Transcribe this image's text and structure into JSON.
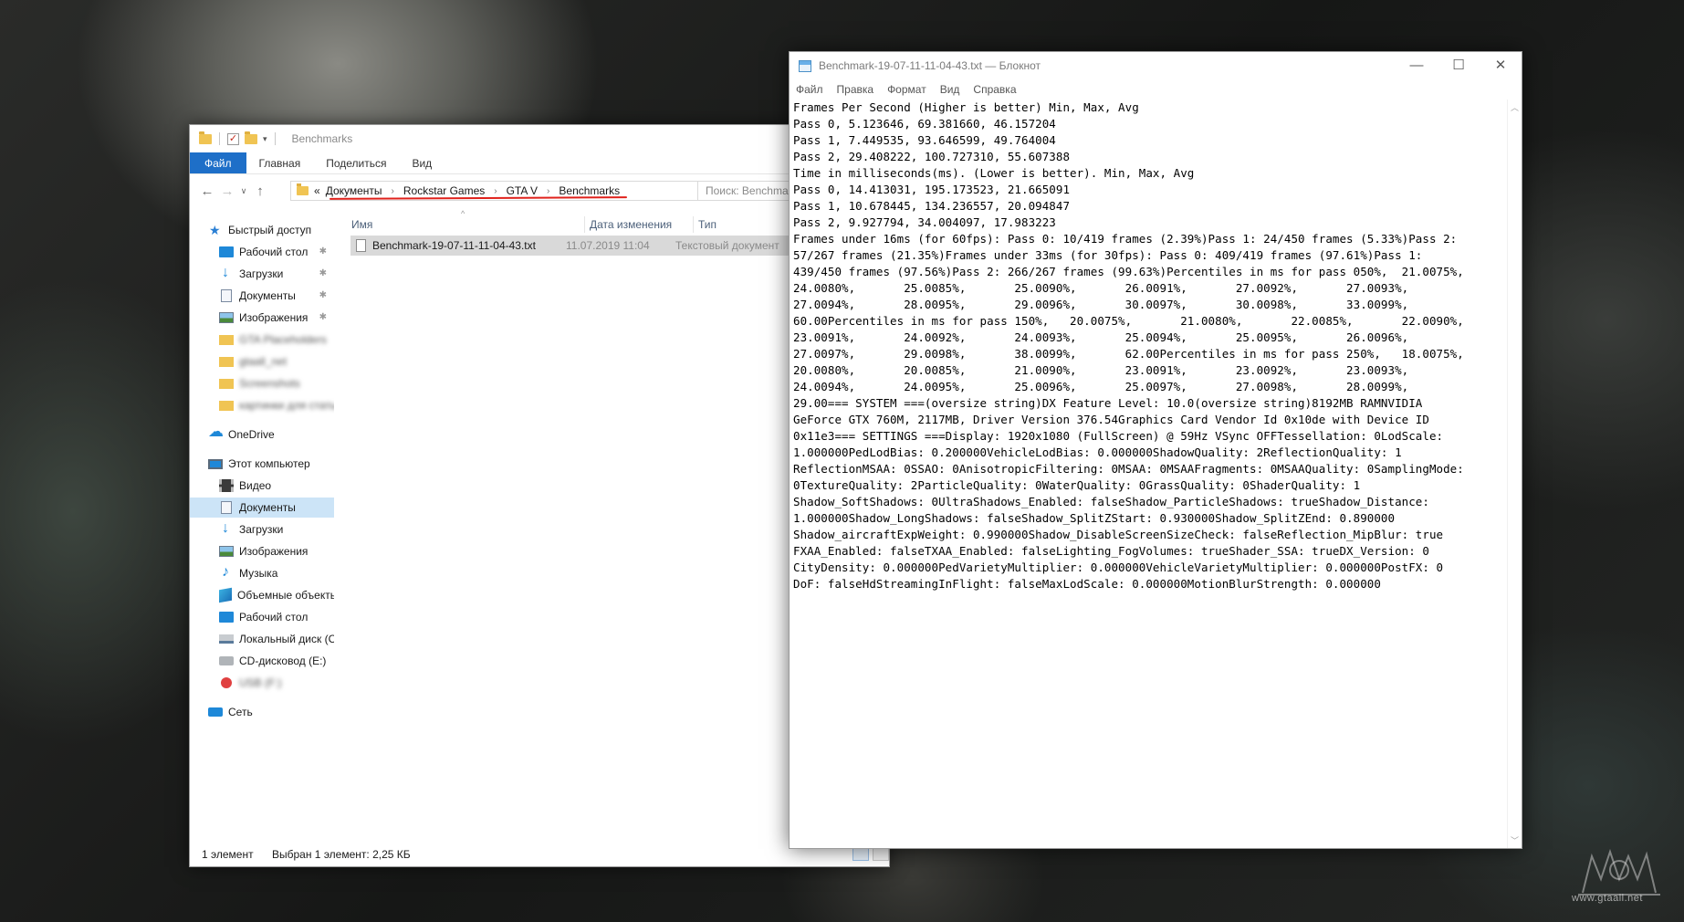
{
  "explorer": {
    "title": "Benchmarks",
    "ribbon_tabs": [
      "Файл",
      "Главная",
      "Поделиться",
      "Вид"
    ],
    "address": {
      "overflow": "«",
      "crumbs": [
        "Документы",
        "Rockstar Games",
        "GTA V",
        "Benchmarks"
      ]
    },
    "search_placeholder": "Поиск: Benchmarks",
    "nav": {
      "quick_access": "Быстрый доступ",
      "quick_items": [
        "Рабочий стол",
        "Загрузки",
        "Документы",
        "Изображения"
      ],
      "blurred_items": [
        "GTA Placeholders",
        "gtaall_net",
        "Screenshots",
        "картинки для статьи"
      ],
      "onedrive": "OneDrive",
      "this_pc": "Этот компьютер",
      "pc_items": [
        "Видео",
        "Документы",
        "Загрузки",
        "Изображения",
        "Музыка",
        "Объемные объекты",
        "Рабочий стол",
        "Локальный диск (C:)",
        "CD-дисковод (E:)"
      ],
      "blurred_drive": "USB (F:)",
      "network": "Сеть"
    },
    "columns": {
      "name": "Имя",
      "date": "Дата изменения",
      "type": "Тип"
    },
    "file": {
      "name": "Benchmark-19-07-11-11-04-43.txt",
      "date": "11.07.2019 11:04",
      "type": "Текстовый документ"
    },
    "status": {
      "count": "1 элемент",
      "selected": "Выбран 1 элемент: 2,25 КБ"
    }
  },
  "notepad": {
    "title": "Benchmark-19-07-11-11-04-43.txt — Блокнот",
    "menu": [
      "Файл",
      "Правка",
      "Формат",
      "Вид",
      "Справка"
    ],
    "lines": [
      "Frames Per Second (Higher is better) Min, Max, Avg",
      "Pass 0, 5.123646, 69.381660, 46.157204",
      "Pass 1, 7.449535, 93.646599, 49.764004",
      "Pass 2, 29.408222, 100.727310, 55.607388",
      "Time in milliseconds(ms). (Lower is better). Min, Max, Avg",
      "Pass 0, 14.413031, 195.173523, 21.665091",
      "Pass 1, 10.678445, 134.236557, 20.094847",
      "Pass 2, 9.927794, 34.004097, 17.983223",
      "Frames under 16ms (for 60fps): Pass 0: 10/419 frames (2.39%)Pass 1: 24/450 frames (5.33%)Pass 2:",
      "57/267 frames (21.35%)Frames under 33ms (for 30fps): Pass 0: 409/419 frames (97.61%)Pass 1:",
      "439/450 frames (97.56%)Pass 2: 266/267 frames (99.63%)Percentiles in ms for pass 050%,  21.0075%,",
      "24.0080%,       25.0085%,       25.0090%,       26.0091%,       27.0092%,       27.0093%,",
      "27.0094%,       28.0095%,       29.0096%,       30.0097%,       30.0098%,       33.0099%,",
      "60.00Percentiles in ms for pass 150%,   20.0075%,       21.0080%,       22.0085%,       22.0090%,",
      "23.0091%,       24.0092%,       24.0093%,       25.0094%,       25.0095%,       26.0096%,",
      "27.0097%,       29.0098%,       38.0099%,       62.00Percentiles in ms for pass 250%,   18.0075%,",
      "20.0080%,       20.0085%,       21.0090%,       23.0091%,       23.0092%,       23.0093%,",
      "24.0094%,       24.0095%,       25.0096%,       25.0097%,       27.0098%,       28.0099%,",
      "29.00=== SYSTEM ===(oversize string)DX Feature Level: 10.0(oversize string)8192MB RAMNVIDIA",
      "GeForce GTX 760M, 2117MB, Driver Version 376.54Graphics Card Vendor Id 0x10de with Device ID",
      "0x11e3=== SETTINGS ===Display: 1920x1080 (FullScreen) @ 59Hz VSync OFFTessellation: 0LodScale:",
      "1.000000PedLodBias: 0.200000VehicleLodBias: 0.000000ShadowQuality: 2ReflectionQuality: 1",
      "ReflectionMSAA: 0SSAO: 0AnisotropicFiltering: 0MSAA: 0MSAAFragments: 0MSAAQuality: 0SamplingMode:",
      "0TextureQuality: 2ParticleQuality: 0WaterQuality: 0GrassQuality: 0ShaderQuality: 1",
      "Shadow_SoftShadows: 0UltraShadows_Enabled: falseShadow_ParticleShadows: trueShadow_Distance:",
      "1.000000Shadow_LongShadows: falseShadow_SplitZStart: 0.930000Shadow_SplitZEnd: 0.890000",
      "Shadow_aircraftExpWeight: 0.990000Shadow_DisableScreenSizeCheck: falseReflection_MipBlur: true",
      "FXAA_Enabled: falseTXAA_Enabled: falseLighting_FogVolumes: trueShader_SSA: trueDX_Version: 0",
      "CityDensity: 0.000000PedVarietyMultiplier: 0.000000VehicleVarietyMultiplier: 0.000000PostFX: 0",
      "DoF: falseHdStreamingInFlight: falseMaxLodScale: 0.000000MotionBlurStrength: 0.000000"
    ]
  },
  "watermark": "www.gtaall.net",
  "colors": {
    "accent": "#1e6fc8",
    "underline": "#e0211b",
    "selection": "#cce4f7"
  }
}
